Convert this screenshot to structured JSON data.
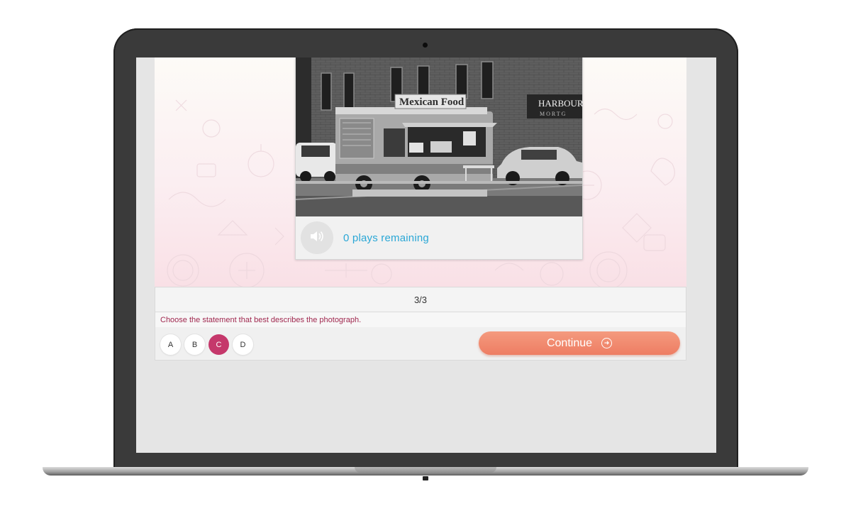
{
  "question": {
    "audio_status": "0 plays remaining",
    "counter": "3/3",
    "prompt": "Choose the statement that best describes the photograph."
  },
  "photo": {
    "sign_truck": "Mexican Food",
    "sign_building": "HARBOUR",
    "sign_building_sub": "MORTG"
  },
  "answers": {
    "options": [
      "A",
      "B",
      "C",
      "D"
    ],
    "selected": "C"
  },
  "actions": {
    "continue_label": "Continue"
  },
  "icons": {
    "speaker": "speaker-icon",
    "continue_arrow": "arrow-right-circle-icon"
  },
  "colors": {
    "accent_selected": "#c5386b",
    "continue_button": "#ee7d63",
    "audio_text": "#2aa7d6",
    "prompt_text": "#a0284f"
  }
}
